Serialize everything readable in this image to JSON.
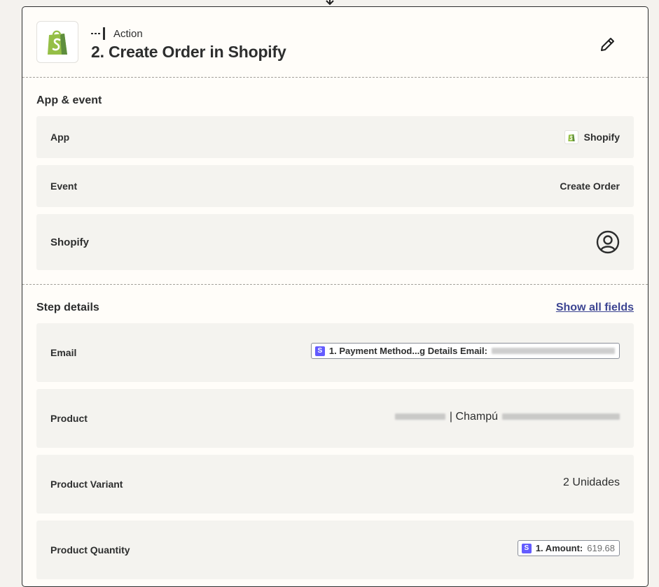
{
  "step": {
    "kind_label": "Action",
    "title": "2. Create Order in Shopify"
  },
  "app_event": {
    "section_title": "App & event",
    "rows": [
      {
        "label": "App",
        "value": "Shopify"
      },
      {
        "label": "Event",
        "value": "Create Order"
      },
      {
        "label": "Shopify",
        "value": ""
      }
    ]
  },
  "step_details": {
    "section_title": "Step details",
    "show_all_label": "Show all fields",
    "fields": [
      {
        "label": "Email",
        "pill_label": "1. Payment Method...g Details Email:",
        "pill_badge": "S"
      },
      {
        "label": "Product",
        "value_visible": "| Champú"
      },
      {
        "label": "Product Variant",
        "value": "2 Unidades"
      },
      {
        "label": "Product Quantity",
        "pill_label": "1. Amount:",
        "pill_value": "619.68",
        "pill_badge": "S"
      }
    ]
  },
  "colors": {
    "shopify_green": "#95bf47",
    "link": "#3d4592",
    "stripe_badge": "#635bff"
  },
  "icons": [
    "connector-arrow-icon",
    "shopify-logo-icon",
    "action-step-icon",
    "pencil-edit-icon",
    "user-account-icon",
    "stripe-badge-icon"
  ]
}
